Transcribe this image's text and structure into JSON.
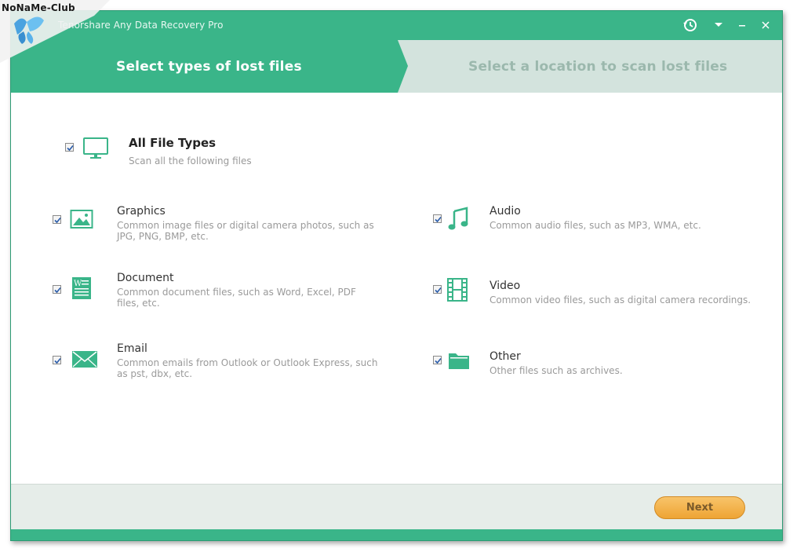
{
  "watermark": {
    "text": "NoNaMe-Club"
  },
  "window": {
    "title": "Tenorshare Any Data Recovery Pro",
    "controls": [
      "history-icon",
      "dropdown-icon",
      "minimize-icon",
      "close-icon"
    ]
  },
  "steps": {
    "step1": "Select types of lost files",
    "step2": "Select a location to scan lost files"
  },
  "all_types": {
    "title": "All File Types",
    "description": "Scan all the following files",
    "checked": true,
    "icon": "monitor-icon"
  },
  "file_types": [
    {
      "title": "Graphics",
      "desc_line1": "Common image files or digital camera photos, such as",
      "desc_line2": "JPG, PNG, BMP, etc.",
      "icon": "image-icon",
      "checked": true
    },
    {
      "title": "Document",
      "desc_line1": "Common document files, such as Word, Excel, PDF",
      "desc_line2": "files, etc.",
      "icon": "document-icon",
      "checked": true
    },
    {
      "title": "Email",
      "desc_line1": "Common emails from Outlook or Outlook Express, such",
      "desc_line2": "as pst, dbx, etc.",
      "icon": "email-icon",
      "checked": true
    },
    {
      "title": "Audio",
      "desc_line1": "Common audio files, such as MP3, WMA, etc.",
      "desc_line2": "",
      "icon": "music-note-icon",
      "checked": true
    },
    {
      "title": "Video",
      "desc_line1": "Common video files, such as digital camera recordings.",
      "desc_line2": "",
      "icon": "film-icon",
      "checked": true
    },
    {
      "title": "Other",
      "desc_line1": "Other files such as archives.",
      "desc_line2": "",
      "icon": "folder-icon",
      "checked": true
    }
  ],
  "footer": {
    "next_label": "Next"
  },
  "colors": {
    "accent": "#3ab589",
    "step_inactive_bg": "#d3e3dd",
    "button_orange": "#f0a83a"
  }
}
